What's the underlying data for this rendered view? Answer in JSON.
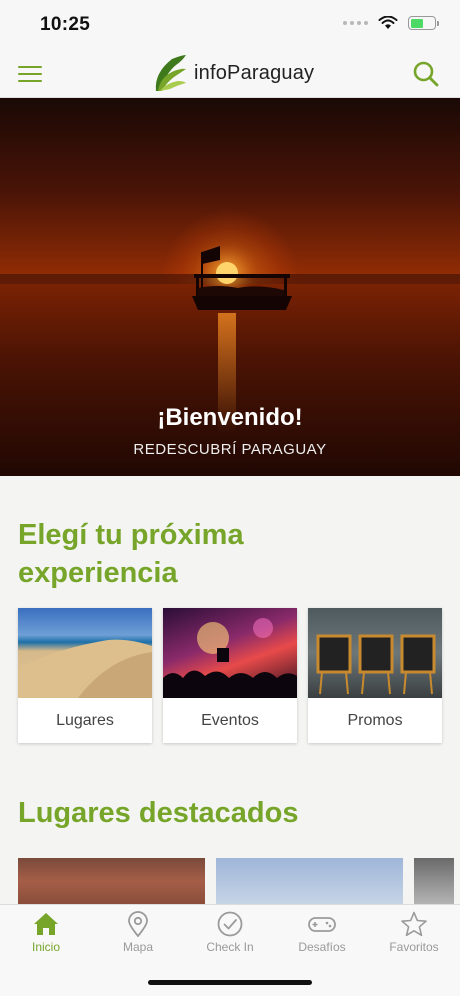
{
  "status_bar": {
    "time": "10:25"
  },
  "header": {
    "logo_text": "infoParaguay"
  },
  "hero": {
    "title": "¡Bienvenido!",
    "subtitle": "REDESCUBRÍ PARAGUAY"
  },
  "experience": {
    "title": "Elegí tu próxima experiencia",
    "cards": [
      {
        "label": "Lugares"
      },
      {
        "label": "Eventos"
      },
      {
        "label": "Promos"
      }
    ]
  },
  "featured": {
    "title": "Lugares destacados"
  },
  "tabbar": {
    "tabs": [
      {
        "label": "Inicio",
        "icon": "home-icon",
        "active": true
      },
      {
        "label": "Mapa",
        "icon": "map-pin-icon"
      },
      {
        "label": "Check In",
        "icon": "check-circle-icon"
      },
      {
        "label": "Desafíos",
        "icon": "gamepad-icon"
      },
      {
        "label": "Favoritos",
        "icon": "star-icon"
      }
    ],
    "accent_color": "#76a52a",
    "inactive_color": "#9a9a9a"
  }
}
